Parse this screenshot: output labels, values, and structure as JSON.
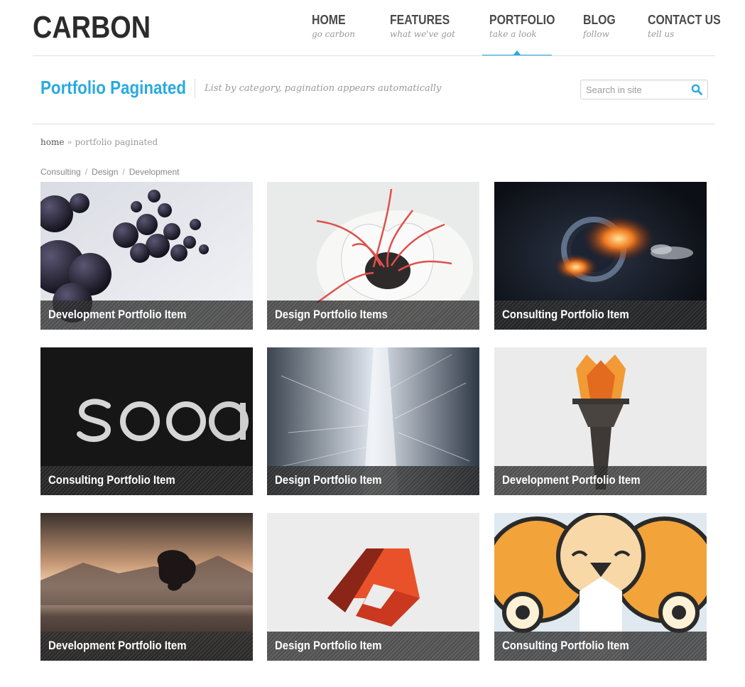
{
  "header": {
    "logo": "CARBON",
    "nav": [
      {
        "label": "HOME",
        "sub": "go carbon"
      },
      {
        "label": "FEATURES",
        "sub": "what we've got"
      },
      {
        "label": "PORTFOLIO",
        "sub": "take a look"
      },
      {
        "label": "BLOG",
        "sub": "follow"
      },
      {
        "label": "CONTACT US",
        "sub": "tell us"
      }
    ]
  },
  "page": {
    "title": "Portfolio Paginated",
    "description": "List by category, pagination appears automatically"
  },
  "search": {
    "placeholder": "Search in site",
    "value": ""
  },
  "breadcrumb": {
    "home": "home",
    "separator": "»",
    "current": "portfolio paginated"
  },
  "filters": {
    "items": [
      "Consulting",
      "Design",
      "Development"
    ],
    "separator": "/"
  },
  "portfolio": {
    "items": [
      {
        "title": "Development Portfolio Item"
      },
      {
        "title": "Design Portfolio Items"
      },
      {
        "title": "Consulting Portfolio Item"
      },
      {
        "title": "Consulting Portfolio Item"
      },
      {
        "title": "Design Portfolio Item"
      },
      {
        "title": "Development Portfolio Item"
      },
      {
        "title": "Development Portfolio Item"
      },
      {
        "title": "Design Portfolio Item"
      },
      {
        "title": "Consulting Portfolio Item"
      }
    ]
  },
  "colors": {
    "accent": "#29a9e1",
    "logo": "#2b2b2b",
    "nav": "#4a4a4a"
  }
}
